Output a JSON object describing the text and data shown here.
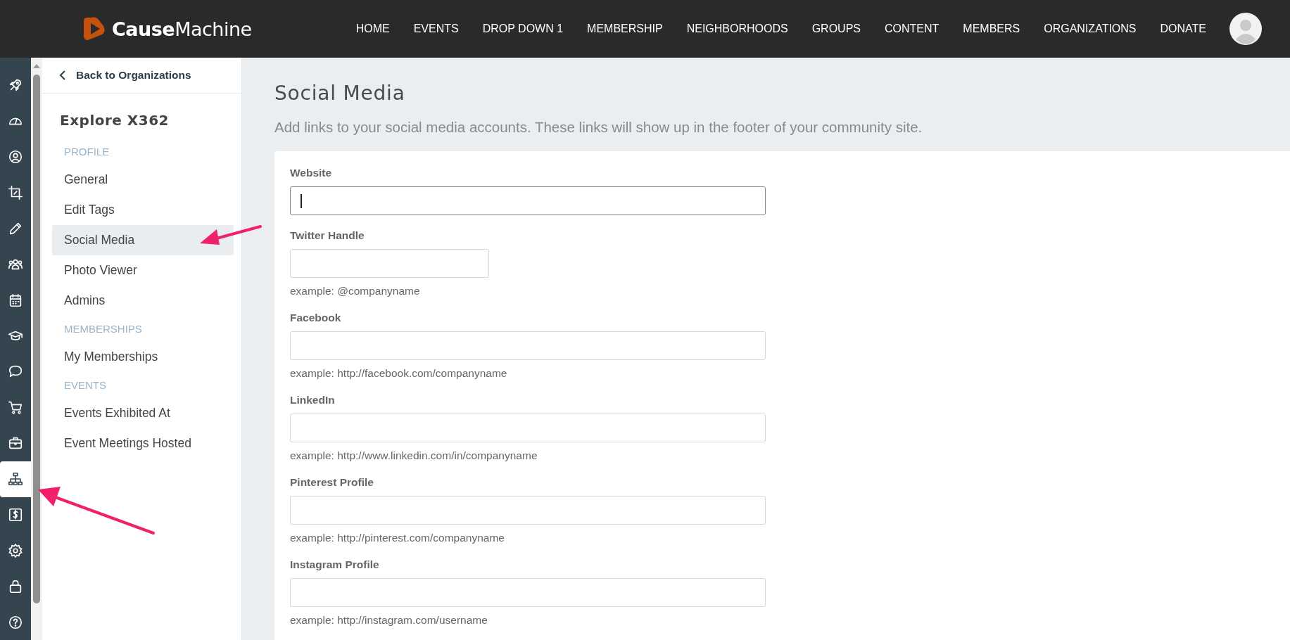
{
  "header": {
    "logo": "**Cause**Machine",
    "menu": [
      {
        "label": "HOME"
      },
      {
        "label": "EVENTS"
      },
      {
        "label": "DROP DOWN 1"
      },
      {
        "label": "MEMBERSHIP"
      },
      {
        "label": "NEIGHBORHOODS"
      },
      {
        "label": "GROUPS"
      },
      {
        "label": "CONTENT"
      },
      {
        "label": "MEMBERS"
      },
      {
        "label": "ORGANIZATIONS"
      },
      {
        "label": "DONATE"
      }
    ]
  },
  "icon_rail": [
    {
      "selected": false
    },
    {
      "selected": false
    },
    {
      "selected": false
    },
    {
      "selected": false
    },
    {
      "selected": false
    },
    {
      "selected": false
    },
    {
      "selected": false
    },
    {
      "selected": false
    },
    {
      "selected": false
    },
    {
      "selected": false
    },
    {
      "selected": false
    },
    {
      "selected": true
    },
    {
      "selected": false
    },
    {
      "selected": false
    },
    {
      "selected": false
    },
    {
      "selected": false
    }
  ],
  "sidebar": {
    "back_link": "Back to Organizations",
    "title": "Explore X362",
    "sections": [
      {
        "heading": "PROFILE",
        "items": [
          {
            "label": "General",
            "selected": false
          },
          {
            "label": "Edit Tags",
            "selected": false
          },
          {
            "label": "Social Media",
            "selected": true
          },
          {
            "label": "Photo Viewer",
            "selected": false
          },
          {
            "label": "Admins",
            "selected": false
          }
        ]
      },
      {
        "heading": "MEMBERSHIPS",
        "items": [
          {
            "label": "My Memberships",
            "selected": false
          }
        ]
      },
      {
        "heading": "EVENTS",
        "items": [
          {
            "label": "Events Exhibited At",
            "selected": false
          },
          {
            "label": "Event Meetings Hosted",
            "selected": false
          }
        ]
      }
    ]
  },
  "main": {
    "title": "Social Media",
    "description": "Add links to your social media accounts. These links will show up in the footer of your community site.",
    "fields": [
      {
        "label": "Website",
        "kind": "wide",
        "focused": true
      },
      {
        "label": "Twitter Handle",
        "kind": "short",
        "focused": false,
        "help": "example: @companyname"
      },
      {
        "label": "Facebook",
        "kind": "wide",
        "focused": false,
        "help": "example: http://facebook.com/companyname"
      },
      {
        "label": "LinkedIn",
        "kind": "wide",
        "focused": false,
        "help": "example: http://www.linkedin.com/in/companyname"
      },
      {
        "label": "Pinterest Profile",
        "kind": "wide",
        "focused": false,
        "help": "example: http://pinterest.com/companyname"
      },
      {
        "label": "Instagram Profile",
        "kind": "wide",
        "focused": false,
        "help": "example: http://instagram.com/username"
      }
    ]
  }
}
